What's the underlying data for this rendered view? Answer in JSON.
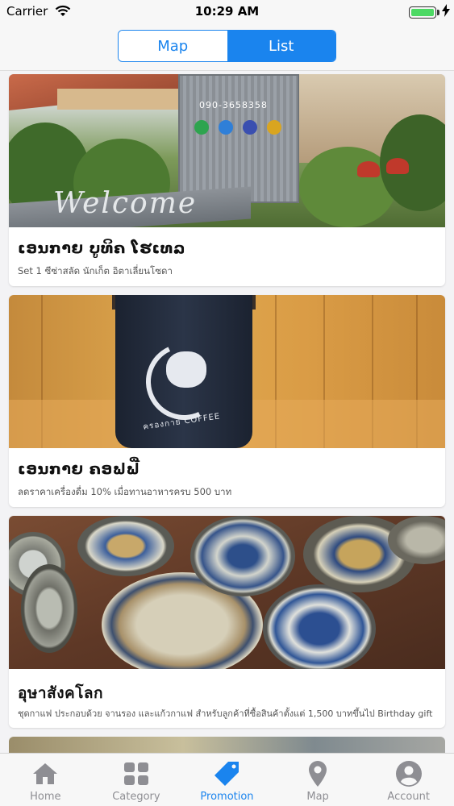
{
  "status_bar": {
    "carrier": "Carrier",
    "time": "10:29 AM",
    "battery_level": 1.0
  },
  "header": {
    "segments": [
      "Map",
      "List"
    ],
    "selected_segment": "List"
  },
  "cards": [
    {
      "title": "ເອນກາຍ ບູທິຄ ໂຮເທລ",
      "description": "Set 1 ซีซ่าสลัด นักเก็ต อิตาเลี่ยนโซดา",
      "image_sign_number": "090-3658358",
      "image_sign_text": "Welcome"
    },
    {
      "title": "ເອນກາຍ ຄອຟຟີ່",
      "description": "ลดราคาเครื่องดื่ม 10% เมื่อทานอาหารครบ 500 บาท",
      "image_cup_brand": "ครองกาย COFFEE"
    },
    {
      "title": "อุษาสังคโลก",
      "description": "ชุดกาแฟ ประกอบด้วย จานรอง และแก้วกาแฟ สำหรับลูกค้าที่ซื้อสินค้าตั้งแต่ 1,500 บาทขึ้นไป Birthday gift"
    }
  ],
  "tabbar": {
    "items": [
      {
        "label": "Home",
        "icon": "home-icon"
      },
      {
        "label": "Category",
        "icon": "grid-icon"
      },
      {
        "label": "Promotion",
        "icon": "tag-icon"
      },
      {
        "label": "Map",
        "icon": "map-pin-icon"
      },
      {
        "label": "Account",
        "icon": "user-icon"
      }
    ],
    "active": "Promotion"
  },
  "colors": {
    "accent": "#1a84ee",
    "inactive": "#8e8e93",
    "battery": "#4cd964"
  }
}
